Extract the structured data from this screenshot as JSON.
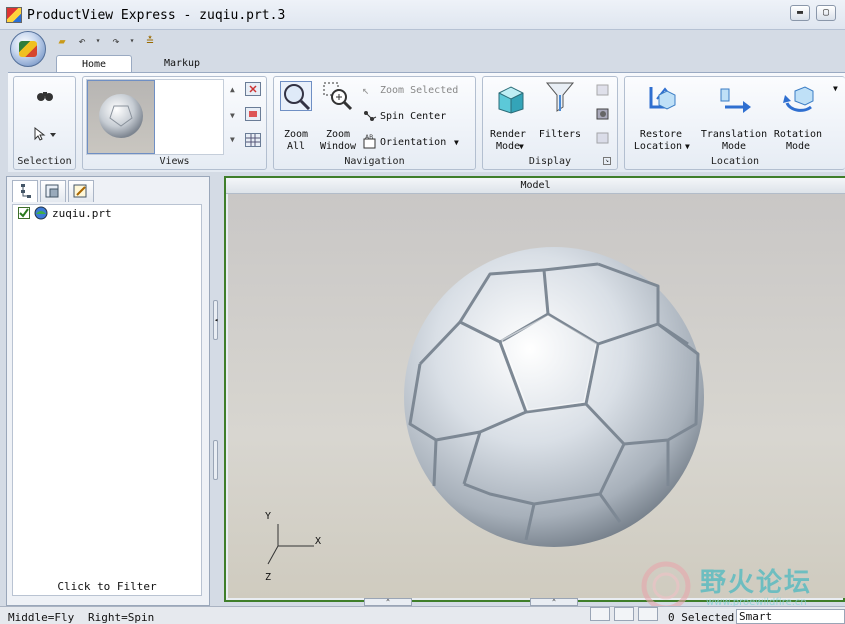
{
  "window": {
    "title": "ProductView Express - zuqiu.prt.3",
    "min_label": "▬",
    "max_label": "▢"
  },
  "quick_access": {
    "open_icon": "folder-open-icon",
    "undo_icon": "undo-icon",
    "redo_icon": "redo-icon",
    "customize_icon": "customize-icon"
  },
  "tabs": [
    {
      "label": "Home"
    },
    {
      "label": "Markup"
    }
  ],
  "ribbon": {
    "selection": {
      "label": "Selection"
    },
    "views": {
      "label": "Views"
    },
    "navigation": {
      "label": "Navigation",
      "zoom_all": "Zoom\nAll",
      "zoom_all_l1": "Zoom",
      "zoom_all_l2": "All",
      "zoom_window_l1": "Zoom",
      "zoom_window_l2": "Window",
      "zoom_selected": "Zoom Selected",
      "spin_center": "Spin Center",
      "orientation": "Orientation"
    },
    "display": {
      "label": "Display",
      "render_l1": "Render",
      "render_l2": "Mode",
      "filters": "Filters"
    },
    "location": {
      "label": "Location",
      "restore_l1": "Restore",
      "restore_l2": "Location",
      "translation_l1": "Translation",
      "translation_l2": "Mode",
      "rotation_l1": "Rotation",
      "rotation_l2": "Mode"
    }
  },
  "tree": {
    "items": [
      {
        "label": "zuqiu.prt",
        "checked": true
      }
    ],
    "filter_label": "Click to Filter"
  },
  "model": {
    "title": "Model",
    "axes": {
      "x": "X",
      "y": "Y",
      "z": "Z"
    }
  },
  "status": {
    "middle": "Middle=Fly",
    "right": "Right=Spin",
    "selected": "0 Selected",
    "mode": "Smart"
  },
  "watermark": {
    "text": "野火论坛",
    "url": "www.proewildfire.cn"
  },
  "colors": {
    "accent_green": "#3f7e2a",
    "ribbon_blue": "#9aaac2"
  }
}
